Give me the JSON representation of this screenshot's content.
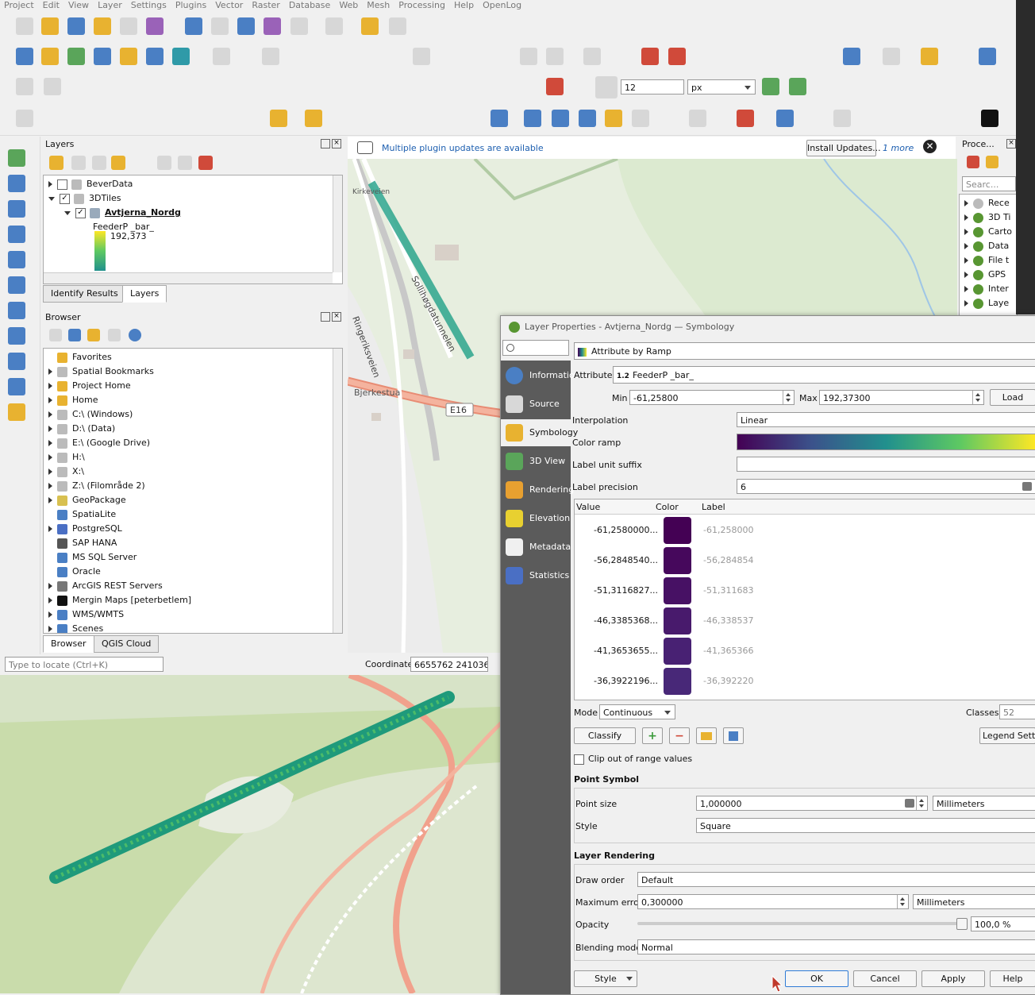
{
  "menu": [
    "Project",
    "Edit",
    "View",
    "Layer",
    "Settings",
    "Plugins",
    "Vector",
    "Raster",
    "Database",
    "Web",
    "Mesh",
    "Processing",
    "Help",
    "OpenLog"
  ],
  "toolbar": {
    "snap_tolerance": "12",
    "snap_unit": "px"
  },
  "layers_panel": {
    "title": "Layers",
    "items": [
      {
        "label": "BeverData",
        "checked": false
      },
      {
        "label": "3DTiles",
        "checked": true
      },
      {
        "label": "Avtjerna_Nordg",
        "checked": true
      }
    ],
    "legend_attr": "FeederP _bar_",
    "legend_max": "192,373",
    "tabs": [
      "Identify Results",
      "Layers"
    ]
  },
  "browser_panel": {
    "title": "Browser",
    "items": [
      "Favorites",
      "Spatial Bookmarks",
      "Project Home",
      "Home",
      "C:\\ (Windows)",
      "D:\\ (Data)",
      "E:\\ (Google Drive)",
      "H:\\",
      "X:\\",
      "Z:\\ (Filområde 2)",
      "GeoPackage",
      "SpatiaLite",
      "PostgreSQL",
      "SAP HANA",
      "MS SQL Server",
      "Oracle",
      "ArcGIS REST Servers",
      "Mergin Maps [peterbetlem]",
      "WMS/WMTS",
      "Scenes"
    ],
    "tabs": [
      "Browser",
      "QGIS Cloud"
    ]
  },
  "status": {
    "locate_placeholder": "Type to locate (Ctrl+K)",
    "coordinate_label": "Coordinate",
    "coordinate_value": "6655762  241036"
  },
  "message_bar": {
    "text": "Multiple plugin updates are available",
    "button": "Install Updates...",
    "more": "1 more"
  },
  "processing": {
    "title": "Proce...",
    "search": "Searc...",
    "items": [
      "Rece",
      "3D Ti",
      "Carto",
      "Data",
      "File t",
      "GPS",
      "Inter",
      "Laye"
    ]
  },
  "map_labels": {
    "road1": "Ringeriksveien",
    "road2": "Sollihøgdatunnelen",
    "place": "Bjerkestua",
    "route": "E16",
    "village": "Kirkeveien"
  },
  "dialog": {
    "title": "Layer Properties - Avtjerna_Nordg — Symbology",
    "nav": [
      "Information",
      "Source",
      "Symbology",
      "3D View",
      "Rendering",
      "Elevation",
      "Metadata",
      "Statistics"
    ],
    "renderer": "Attribute by Ramp",
    "attribute_label": "Attribute",
    "attribute_type": "1.2",
    "attribute_value": "FeederP _bar_",
    "min_label": "Min",
    "min_value": "-61,25800",
    "max_label": "Max",
    "max_value": "192,37300",
    "load_button": "Load",
    "interpolation_label": "Interpolation",
    "interpolation_value": "Linear",
    "color_ramp_label": "Color ramp",
    "unit_suffix_label": "Label unit suffix",
    "precision_label": "Label precision",
    "precision_value": "6",
    "table_headers": [
      "Value",
      "Color",
      "Label"
    ],
    "classes": [
      {
        "value": "-61,2580000...",
        "label": "-61,258000",
        "color": "#440154"
      },
      {
        "value": "-56,2848540...",
        "label": "-56,284854",
        "color": "#46085c"
      },
      {
        "value": "-51,3116827...",
        "label": "-51,311683",
        "color": "#471164"
      },
      {
        "value": "-46,3385368...",
        "label": "-46,338537",
        "color": "#481a6c"
      },
      {
        "value": "-41,3653655...",
        "label": "-41,365366",
        "color": "#482173"
      },
      {
        "value": "-36,3922196...",
        "label": "-36,392220",
        "color": "#482878"
      }
    ],
    "mode_label": "Mode",
    "mode_value": "Continuous",
    "classes_label": "Classes",
    "classes_value": "52",
    "classify_button": "Classify",
    "legend_settings_button": "Legend Settings",
    "clip_label": "Clip out of range values",
    "point_symbol_title": "Point Symbol",
    "point_size_label": "Point size",
    "point_size_value": "1,000000",
    "point_size_unit": "Millimeters",
    "style_label": "Style",
    "style_value": "Square",
    "layer_rendering_title": "Layer Rendering",
    "draw_order_label": "Draw order",
    "draw_order_value": "Default",
    "max_error_label": "Maximum error",
    "max_error_value": "0,300000",
    "max_error_unit": "Millimeters",
    "opacity_label": "Opacity",
    "opacity_value": "100,0 %",
    "blending_label": "Blending mode",
    "blending_value": "Normal",
    "footer": {
      "style": "Style",
      "ok": "OK",
      "cancel": "Cancel",
      "apply": "Apply",
      "help": "Help"
    }
  },
  "colors": {
    "ramp_start": "#440154",
    "ramp_mid": "#21908d",
    "ramp_end": "#fde725",
    "nav_bg": "#5b5b5b"
  }
}
